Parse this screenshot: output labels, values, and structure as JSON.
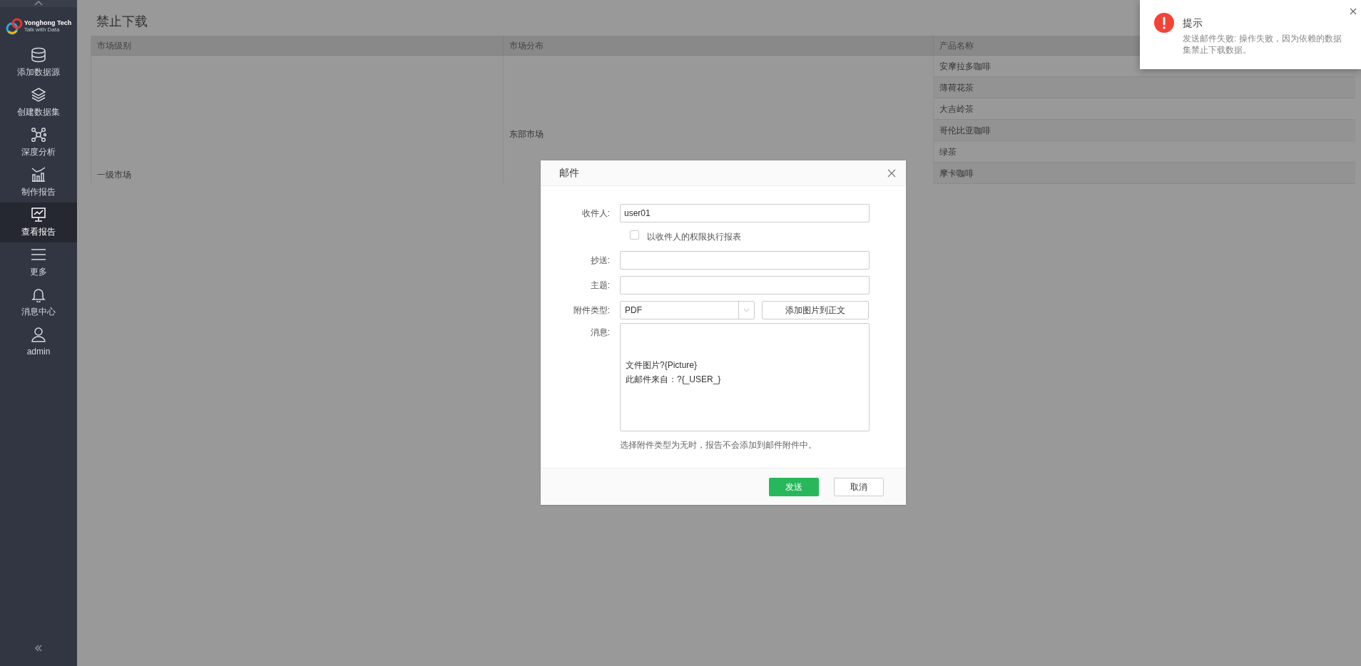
{
  "sidebar": {
    "logo": {
      "name": "Yonghong Tech",
      "tagline": "Talk with Data"
    },
    "items": [
      {
        "label": "添加数据源",
        "selected": false
      },
      {
        "label": "创建数据集",
        "selected": false
      },
      {
        "label": "深度分析",
        "selected": false
      },
      {
        "label": "制作报告",
        "selected": false
      },
      {
        "label": "查看报告",
        "selected": true
      },
      {
        "label": "更多",
        "selected": false
      },
      {
        "label": "消息中心",
        "selected": false
      },
      {
        "label": "admin",
        "selected": false
      }
    ]
  },
  "report": {
    "title": "禁止下载",
    "table": {
      "columns": [
        "市场级别",
        "市场分布",
        "产品名称"
      ],
      "market_level": "一级市场",
      "market_region": "东部市场",
      "products": [
        "安摩拉多咖啡",
        "薄荷花茶",
        "大吉岭茶",
        "哥伦比亚咖啡",
        "绿茶",
        "摩卡咖啡"
      ]
    }
  },
  "dialog": {
    "title": "邮件",
    "fields": [
      {
        "kind": "text",
        "label": "收件人:",
        "value": "user01"
      },
      {
        "kind": "checkbox",
        "label": "以收件人的权限执行报表",
        "checked": false
      },
      {
        "kind": "text",
        "label": "抄送:"
      },
      {
        "kind": "text",
        "label": "主题:"
      },
      {
        "kind": "select",
        "label": "附件类型:",
        "value": "PDF",
        "button": "添加图片到正文"
      },
      {
        "kind": "textarea",
        "label": "消息:",
        "value": "文件图片?{Picture}\n此邮件来自：?{_USER_}"
      }
    ],
    "hint": "选择附件类型为无时，报告不会添加到邮件附件中。",
    "buttons": [
      {
        "label": "发送",
        "primary": true
      },
      {
        "label": "取消",
        "primary": false
      }
    ]
  },
  "toast": {
    "title": "提示",
    "message": "发送邮件失败: 操作失败，因为依赖的数据集禁止下载数据。"
  }
}
